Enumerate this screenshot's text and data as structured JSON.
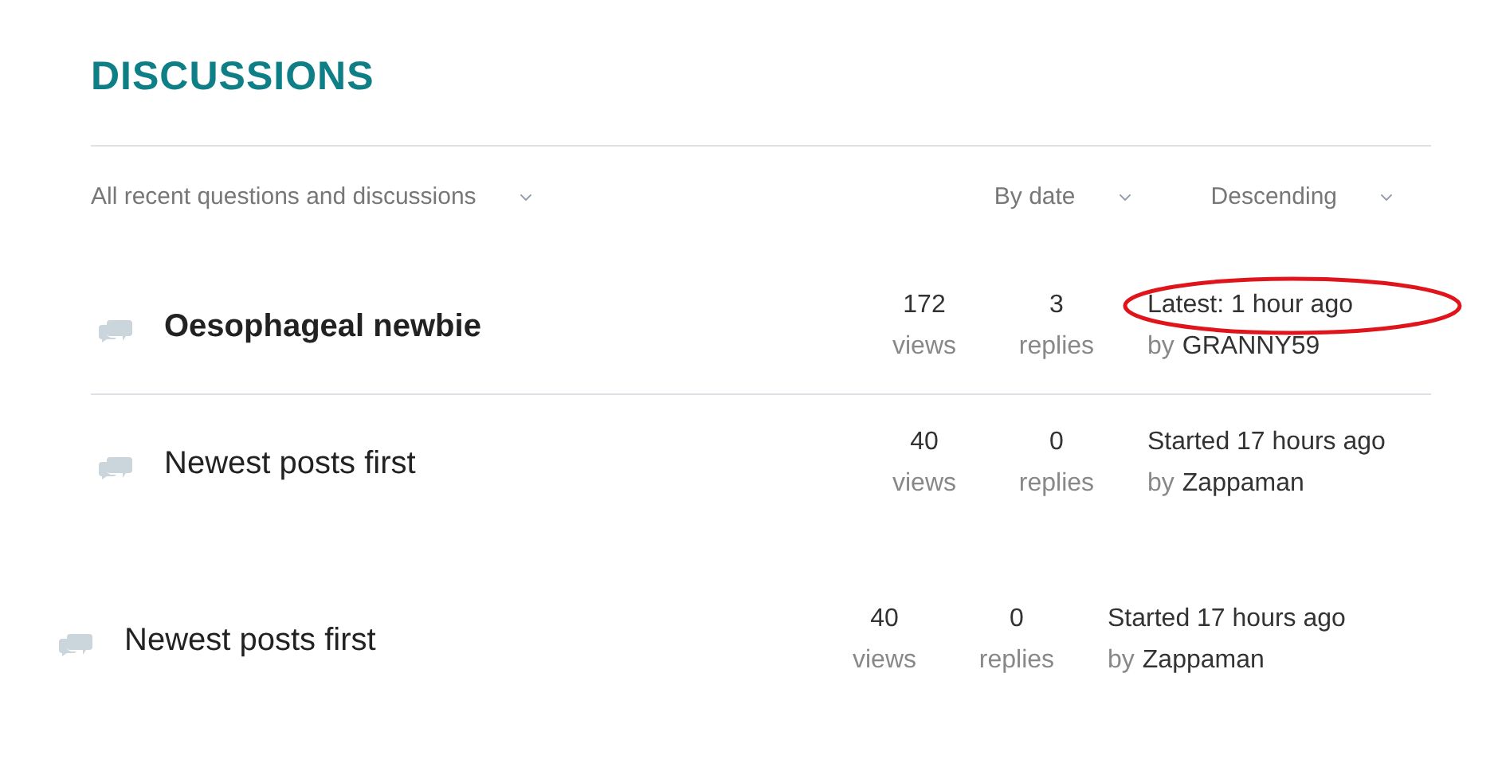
{
  "title": "DISCUSSIONS",
  "filters": {
    "scope": "All recent questions and discussions",
    "sort": "By date",
    "order": "Descending"
  },
  "discussions": [
    {
      "kind": "row",
      "title": "Oesophageal newbie",
      "bold": true,
      "views": "172",
      "views_label": "views",
      "replies": "3",
      "replies_label": "replies",
      "activity": "Latest: 1 hour ago",
      "by": "by",
      "author": "GRANNY59",
      "circled": true,
      "divider": true
    },
    {
      "kind": "row",
      "title": "Newest posts first",
      "bold": false,
      "views": "40",
      "views_label": "views",
      "replies": "0",
      "replies_label": "replies",
      "activity": "Started 17 hours ago",
      "by": "by",
      "author": "Zappaman",
      "circled": false,
      "divider": false
    },
    {
      "kind": "pasted",
      "title": "Newest posts first",
      "bold": false,
      "views": "40",
      "views_label": "views",
      "replies": "0",
      "replies_label": "replies",
      "activity": "Started 17 hours ago",
      "by": "by",
      "author": "Zappaman",
      "circled": false,
      "divider": false
    }
  ]
}
